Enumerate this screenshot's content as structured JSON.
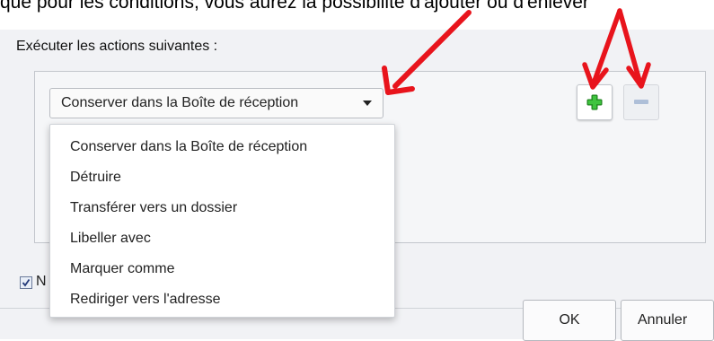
{
  "instruction_text": "que pour les conditions, vous aurez la possibilité d'ajouter ou d'enlever",
  "section_label": "Exécuter les actions suivantes :",
  "selected_action": "Conserver dans la Boîte de réception",
  "dropdown_options": [
    "Conserver dans la Boîte de réception",
    "Détruire",
    "Transférer vers un dossier",
    "Libeller avec",
    "Marquer comme",
    "Rediriger vers l'adresse"
  ],
  "checkbox_label": "N",
  "buttons": {
    "ok": "OK",
    "cancel": "Annuler"
  },
  "colors": {
    "annotation_arrow": "#e8141c",
    "add_icon": "#2fae2f",
    "remove_icon": "#aebfd8"
  },
  "icons": {
    "add": "plus-icon",
    "remove": "minus-icon",
    "dropdown": "caret-down-icon",
    "check": "checkmark-icon"
  }
}
